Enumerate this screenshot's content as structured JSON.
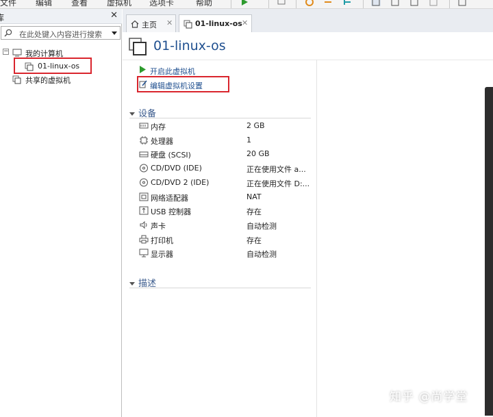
{
  "menubar": {
    "items": [
      "文件",
      "编辑",
      "查看",
      "虚拟机",
      "选项卡",
      "帮助"
    ]
  },
  "library": {
    "title": "库",
    "close_glyph": "✕",
    "search_placeholder": "在此处键入内容进行搜索",
    "tree": {
      "root": "我的计算机",
      "vm": "01-linux-os",
      "shared": "共享的虚拟机"
    }
  },
  "tabs": [
    {
      "label": "主页",
      "close": "✕"
    },
    {
      "label": "01-linux-os",
      "close": "✕"
    }
  ],
  "vm": {
    "title": "01-linux-os",
    "actions": {
      "power_on": "开启此虚拟机",
      "edit_settings": "编辑虚拟机设置"
    },
    "devices_header": "设备",
    "devices": [
      {
        "icon": "memory-icon",
        "name": "内存",
        "value": "2 GB"
      },
      {
        "icon": "processor-icon",
        "name": "处理器",
        "value": "1"
      },
      {
        "icon": "hard-disk-icon",
        "name": "硬盘 (SCSI)",
        "value": "20 GB"
      },
      {
        "icon": "cd-dvd-icon",
        "name": "CD/DVD (IDE)",
        "value": "正在使用文件 a..."
      },
      {
        "icon": "cd-dvd-icon",
        "name": "CD/DVD 2 (IDE)",
        "value": "正在使用文件 D:..."
      },
      {
        "icon": "network-adapter-icon",
        "name": "网络适配器",
        "value": "NAT"
      },
      {
        "icon": "usb-controller-icon",
        "name": "USB 控制器",
        "value": "存在"
      },
      {
        "icon": "sound-card-icon",
        "name": "声卡",
        "value": "自动检测"
      },
      {
        "icon": "printer-icon",
        "name": "打印机",
        "value": "存在"
      },
      {
        "icon": "display-icon",
        "name": "显示器",
        "value": "自动检测"
      }
    ],
    "description_header": "描述"
  },
  "watermark": "知乎 @尚学堂",
  "colors": {
    "accent": "#1f4f8f",
    "highlight_box": "#d9242c",
    "play": "#2e9b2e"
  }
}
